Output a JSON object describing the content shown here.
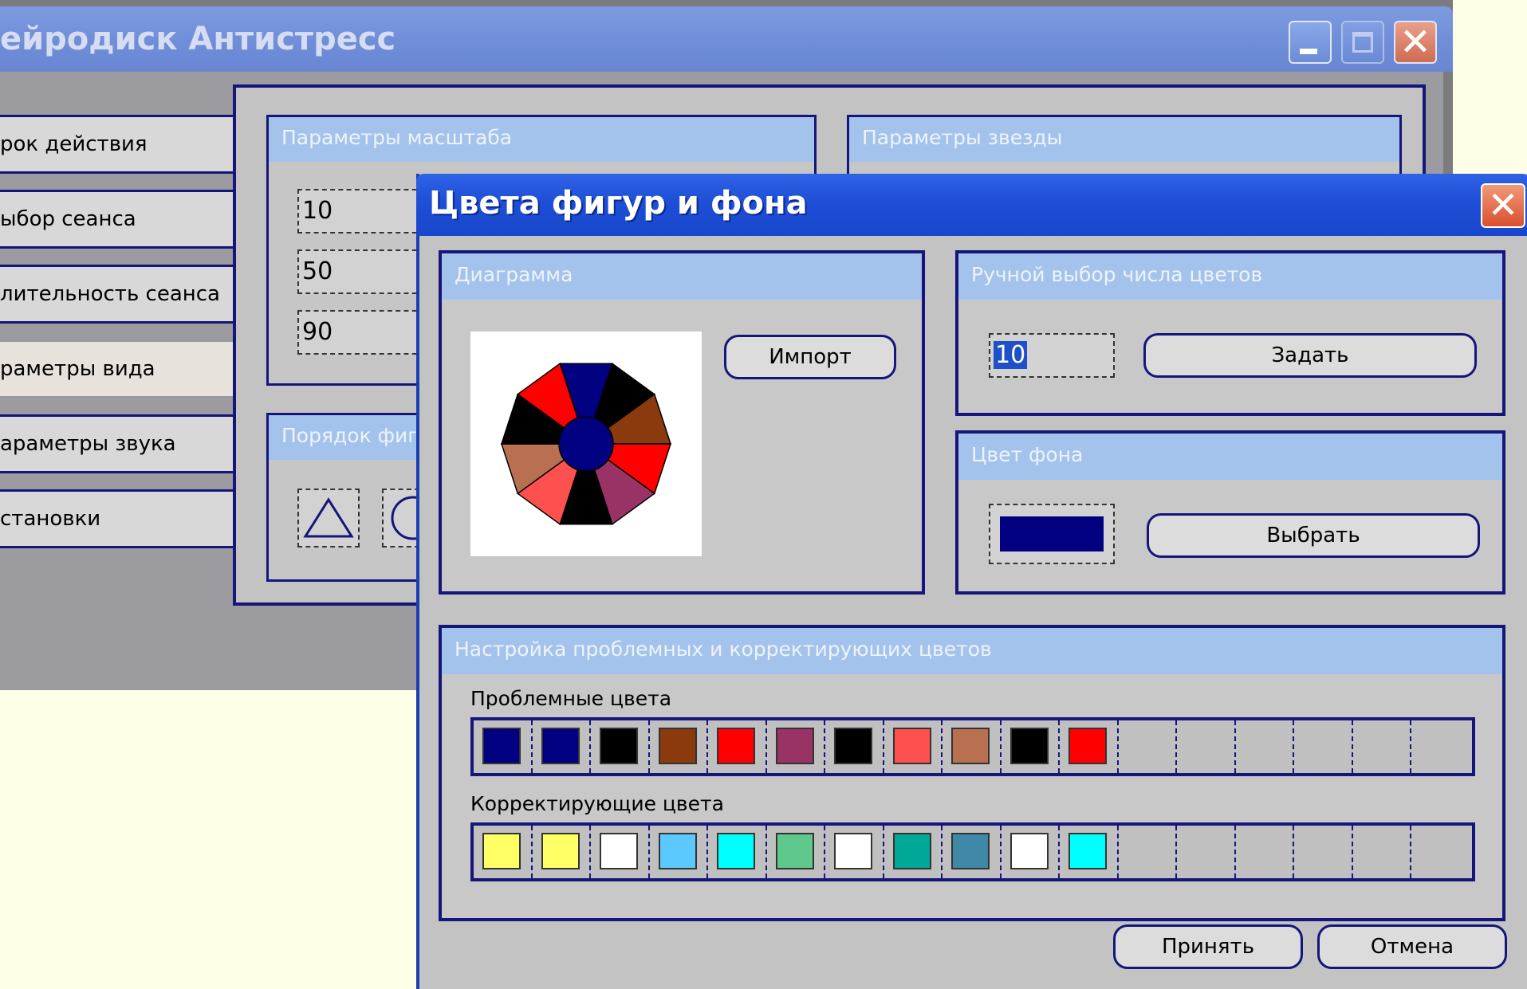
{
  "main_window": {
    "title": "ейродиск Антистресс",
    "nav_items": [
      {
        "label": "рок действия",
        "active": false
      },
      {
        "label": "ыбор сеанса",
        "active": false
      },
      {
        "label": "лительность сеанса",
        "active": false
      },
      {
        "label": "раметры вида",
        "active": true
      },
      {
        "label": "араметры звука",
        "active": false
      },
      {
        "label": "становки",
        "active": false
      }
    ],
    "scale_group": {
      "title": "Параметры масштаба",
      "values": [
        "10",
        "50",
        "90"
      ]
    },
    "star_group": {
      "title": "Параметры звезды"
    },
    "order_group": {
      "title": "Порядок фиг"
    }
  },
  "dialog": {
    "title": "Цвета фигур и фона",
    "diagram": {
      "title": "Диаграмма",
      "import_label": "Импорт",
      "center_color": "#000080",
      "segment_colors": [
        "#000080",
        "#000000",
        "#8b3a0e",
        "#ff0000",
        "#993366",
        "#000000",
        "#ff5050",
        "#b87050",
        "#000000",
        "#ff0000"
      ]
    },
    "manual_count": {
      "title": "Ручной выбор числа цветов",
      "value": "10",
      "set_label": "Задать"
    },
    "background": {
      "title": "Цвет фона",
      "color": "#000080",
      "choose_label": "Выбрать"
    },
    "palette_group": {
      "title": "Настройка проблемных и корректирующих цветов",
      "problem_label": "Проблемные цвета",
      "problem_colors": [
        "#000080",
        "#000080",
        "#000000",
        "#8b3a0e",
        "#ff0000",
        "#993366",
        "#000000",
        "#ff5050",
        "#b87050",
        "#000000",
        "#ff0000",
        "",
        "",
        "",
        "",
        "",
        ""
      ],
      "correction_label": "Корректирующие цвета",
      "correction_colors": [
        "#ffff66",
        "#ffff66",
        "#ffffff",
        "#5bc8ff",
        "#00ffff",
        "#5fc88c",
        "#ffffff",
        "#00a898",
        "#3f88a8",
        "#ffffff",
        "#00ffff",
        "",
        "",
        "",
        "",
        "",
        ""
      ]
    },
    "accept_label": "Принять",
    "cancel_label": "Отмена"
  }
}
